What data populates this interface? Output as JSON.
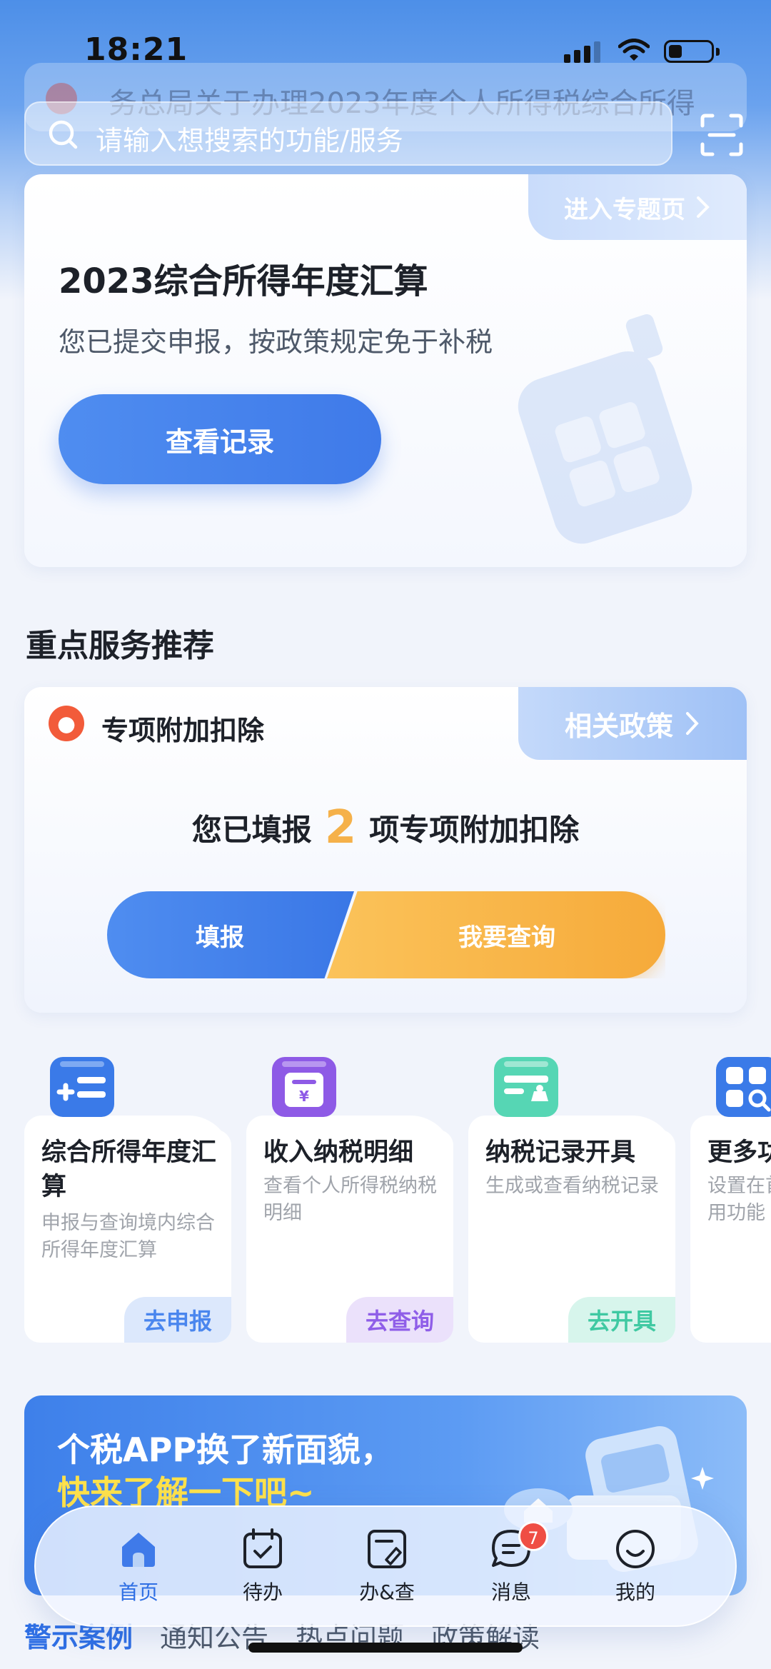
{
  "status_bar": {
    "time": "18:21"
  },
  "notice": {
    "text": "务总局关于办理2023年度个人所得税综合所得"
  },
  "search": {
    "placeholder": "请输入想搜索的功能/服务"
  },
  "annual_card": {
    "topic_link": "进入专题页",
    "title": "2023综合所得年度汇算",
    "subtitle": "您已提交申报，按政策规定免于补税",
    "button": "查看记录"
  },
  "section": {
    "title": "重点服务推荐"
  },
  "deduction": {
    "title": "专项附加扣除",
    "policy_link": "相关政策",
    "prefix": "您已填报",
    "count": "2",
    "suffix": "项专项附加扣除",
    "fill_button": "填报",
    "query_button": "我要查询"
  },
  "tiles": [
    {
      "title": "综合所得年度汇算",
      "desc": "申报与查询境内综合所得年度汇算",
      "action": "去申报",
      "icon": "annual-return-icon",
      "color": "#3a7ae8",
      "action_bg": "#dce8fc",
      "action_color": "#4a86ee"
    },
    {
      "title": "收入纳税明细",
      "desc": "查看个人所得税纳税明细",
      "action": "去查询",
      "icon": "income-detail-icon",
      "color": "#8e5ae6",
      "action_bg": "#ebe1fb",
      "action_color": "#8f5ee8"
    },
    {
      "title": "纳税记录开具",
      "desc": "生成或查看纳税记录",
      "action": "去开具",
      "icon": "tax-record-icon",
      "color": "#4fd1b0",
      "action_bg": "#d7f5ec",
      "action_color": "#3fc9a2"
    },
    {
      "title": "更多功能",
      "desc": "设置在首页展示的常用功能",
      "action": "",
      "icon": "more-apps-icon",
      "color": "#3a7ae8",
      "action_bg": "#ffffff",
      "action_color": "#3a7ae8"
    }
  ],
  "banner": {
    "line1": "个税APP换了新面貌，",
    "line2": "快来了解一下吧~"
  },
  "bottom_tabs": [
    "警示案例",
    "通知公告",
    "热点问题",
    "政策解读"
  ],
  "nav": [
    {
      "label": "首页",
      "icon": "home-icon"
    },
    {
      "label": "待办",
      "icon": "todo-calendar-icon"
    },
    {
      "label": "办&查",
      "icon": "handle-query-icon"
    },
    {
      "label": "消息",
      "icon": "message-icon",
      "badge": "7"
    },
    {
      "label": "我的",
      "icon": "profile-smile-icon"
    }
  ]
}
